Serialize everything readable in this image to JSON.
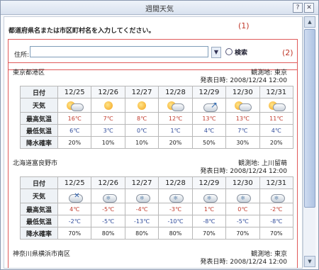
{
  "window": {
    "title": "週間天気",
    "help_label": "?",
    "close_label": "✕"
  },
  "instruction": "都道府県名または市区町村名を入力してください。",
  "markers": {
    "one": "(1)",
    "two": "(2)"
  },
  "search": {
    "label": "住所:",
    "value": "",
    "placeholder": "",
    "button_label": "検索"
  },
  "dates": [
    "12/25",
    "12/26",
    "12/27",
    "12/28",
    "12/29",
    "12/30",
    "12/31"
  ],
  "row_labels": {
    "date": "日付",
    "weather": "天気",
    "high": "最高気温",
    "low": "最低気温",
    "rain": "降水確率"
  },
  "locations": [
    {
      "name": "東京都港区",
      "observatory": "観測地: 東京",
      "announced": "発表日時: 2008/12/24 12:00",
      "weather": [
        "sun-cloud",
        "sun",
        "sun",
        "sun-cloud",
        "cloud-arrow",
        "sun-cloud",
        "sun-cloud"
      ],
      "high": [
        "16℃",
        "7℃",
        "8℃",
        "12℃",
        "13℃",
        "13℃",
        "11℃"
      ],
      "low": [
        "6℃",
        "3℃",
        "0℃",
        "1℃",
        "4℃",
        "7℃",
        "4℃"
      ],
      "rain": [
        "20%",
        "10%",
        "10%",
        "20%",
        "50%",
        "30%",
        "20%"
      ]
    },
    {
      "name": "北海道富良野市",
      "observatory": "観測地: 上川留萌",
      "announced": "発表日時: 2008/12/24 12:00",
      "weather": [
        "cloud-cross",
        "snow-cloud",
        "snow-cloud",
        "snow-cloud",
        "snow-cloud",
        "snow-cloud",
        "snow-cloud"
      ],
      "high": [
        "4℃",
        "-5℃",
        "-4℃",
        "-3℃",
        "1℃",
        "0℃",
        "-2℃"
      ],
      "low": [
        "-2℃",
        "-5℃",
        "-13℃",
        "-10℃",
        "-8℃",
        "-5℃",
        "-8℃"
      ],
      "rain": [
        "70%",
        "80%",
        "80%",
        "80%",
        "70%",
        "70%",
        "70%"
      ]
    },
    {
      "name": "神奈川県横浜市南区",
      "observatory": "観測地: 東京",
      "announced": "発表日時: 2008/12/24 12:00"
    }
  ],
  "icons": {
    "help": "help-icon",
    "close": "close-icon",
    "dropdown": "chevron-down-icon",
    "search": "search-icon"
  }
}
